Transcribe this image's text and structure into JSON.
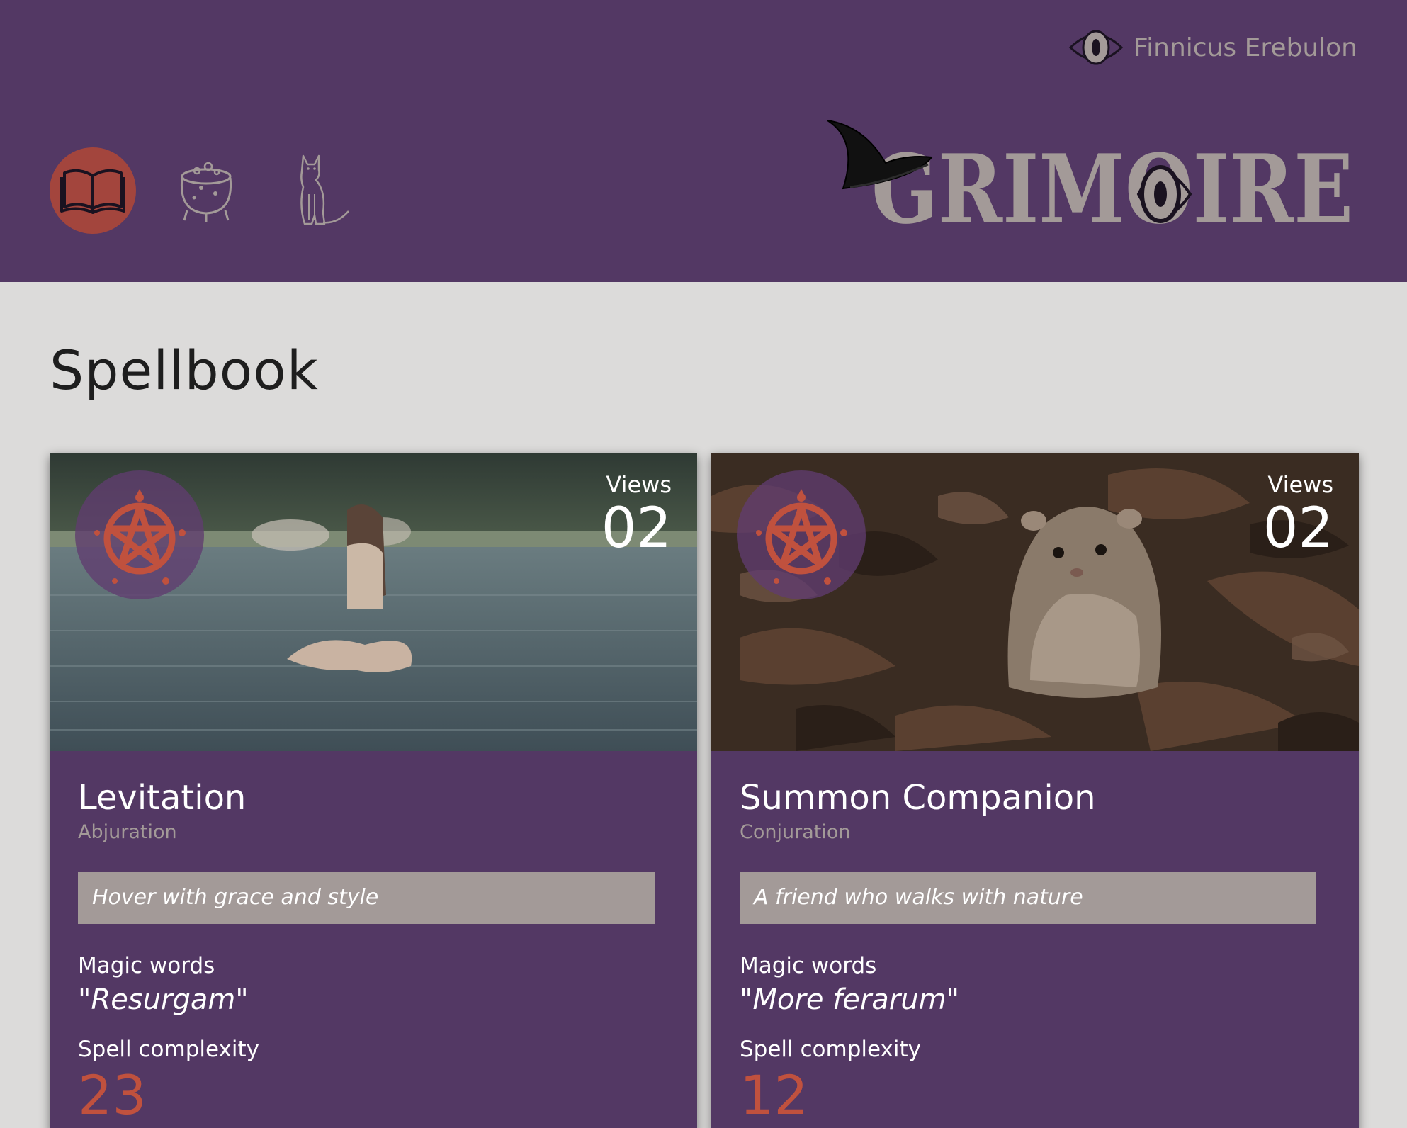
{
  "user": {
    "name": "Finnicus Erebulon",
    "icon": "eye-icon"
  },
  "nav": {
    "items": [
      {
        "icon": "spellbook-icon",
        "active": true
      },
      {
        "icon": "cauldron-icon",
        "active": false
      },
      {
        "icon": "cat-icon",
        "active": false
      }
    ]
  },
  "logo": {
    "text": "GRIMOIRE",
    "icon": "witch-hat-icon"
  },
  "page": {
    "title": "Spellbook"
  },
  "colors": {
    "header": "#533864",
    "background": "#dcdbda",
    "accent": "#a3453d",
    "muted": "#a39a98",
    "complexity": "#c0513e"
  },
  "cards": [
    {
      "name": "Levitation",
      "school": "Abjuration",
      "description": "Hover with grace and style",
      "views_label": "Views",
      "views": "02",
      "magic_words_label": "Magic words",
      "magic_words": "\"Resurgam\"",
      "complexity_label": "Spell complexity",
      "complexity": "23",
      "image": "woman-levitating-over-lake",
      "emblem": "pentacle-icon"
    },
    {
      "name": "Summon Companion",
      "school": "Conjuration",
      "description": "A friend who walks with nature",
      "views_label": "Views",
      "views": "02",
      "magic_words_label": "Magic words",
      "magic_words": "\"More ferarum\"",
      "complexity_label": "Spell complexity",
      "complexity": "12",
      "image": "vole-in-leaves",
      "emblem": "pentacle-icon"
    }
  ]
}
